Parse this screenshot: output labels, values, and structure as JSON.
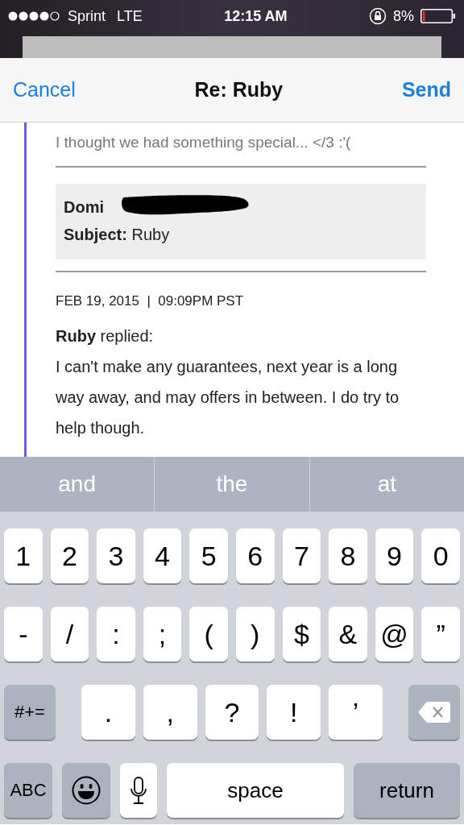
{
  "status_bar": {
    "carrier": "Sprint",
    "network": "LTE",
    "time": "12:15 AM",
    "battery": "8%"
  },
  "nav_bar": {
    "cancel": "Cancel",
    "title": "Re: Ruby",
    "send": "Send"
  },
  "message": {
    "quoted_line": "I thought we had something special... </3 :'(",
    "header": {
      "from_visible": "Domi",
      "subject_label": "Subject:",
      "subject": "Ruby"
    },
    "date": "FEB 19, 2015  |  09:09PM PST",
    "reply_author": "Ruby",
    "reply_verb": "replied:",
    "reply_text": "I can't make any guarantees, next year is a long way away, and may offers in between. I do try to help though."
  },
  "suggestions": [
    "and",
    "the",
    "at"
  ],
  "keyboard": {
    "number_row": [
      {
        "kind": "char",
        "label": "1"
      },
      {
        "kind": "char",
        "label": "2"
      },
      {
        "kind": "char",
        "label": "3"
      },
      {
        "kind": "char",
        "label": "4"
      },
      {
        "kind": "char",
        "label": "5"
      },
      {
        "kind": "char",
        "label": "6"
      },
      {
        "kind": "char",
        "label": "7"
      },
      {
        "kind": "char",
        "label": "8"
      },
      {
        "kind": "char",
        "label": "9"
      },
      {
        "kind": "char",
        "label": "0"
      }
    ],
    "symbol_row": [
      {
        "kind": "char",
        "label": "-"
      },
      {
        "kind": "char",
        "label": "/"
      },
      {
        "kind": "char",
        "label": ":"
      },
      {
        "kind": "char",
        "label": ";"
      },
      {
        "kind": "char",
        "label": "("
      },
      {
        "kind": "char",
        "label": ")"
      },
      {
        "kind": "char",
        "label": "$"
      },
      {
        "kind": "char",
        "label": "&"
      },
      {
        "kind": "char",
        "label": "@"
      },
      {
        "kind": "char",
        "label": "”"
      }
    ],
    "punctuation_row": [
      {
        "kind": "function",
        "label": "#+="
      },
      {
        "kind": "char",
        "label": "."
      },
      {
        "kind": "char",
        "label": ","
      },
      {
        "kind": "char",
        "label": "?"
      },
      {
        "kind": "char",
        "label": "!"
      },
      {
        "kind": "char",
        "label": "’"
      },
      {
        "kind": "delete"
      }
    ],
    "bottom_row": [
      {
        "kind": "function",
        "label": "ABC"
      },
      {
        "kind": "emoji"
      },
      {
        "kind": "mic"
      },
      {
        "kind": "space",
        "label": "space"
      },
      {
        "kind": "function",
        "label": "return"
      }
    ]
  }
}
